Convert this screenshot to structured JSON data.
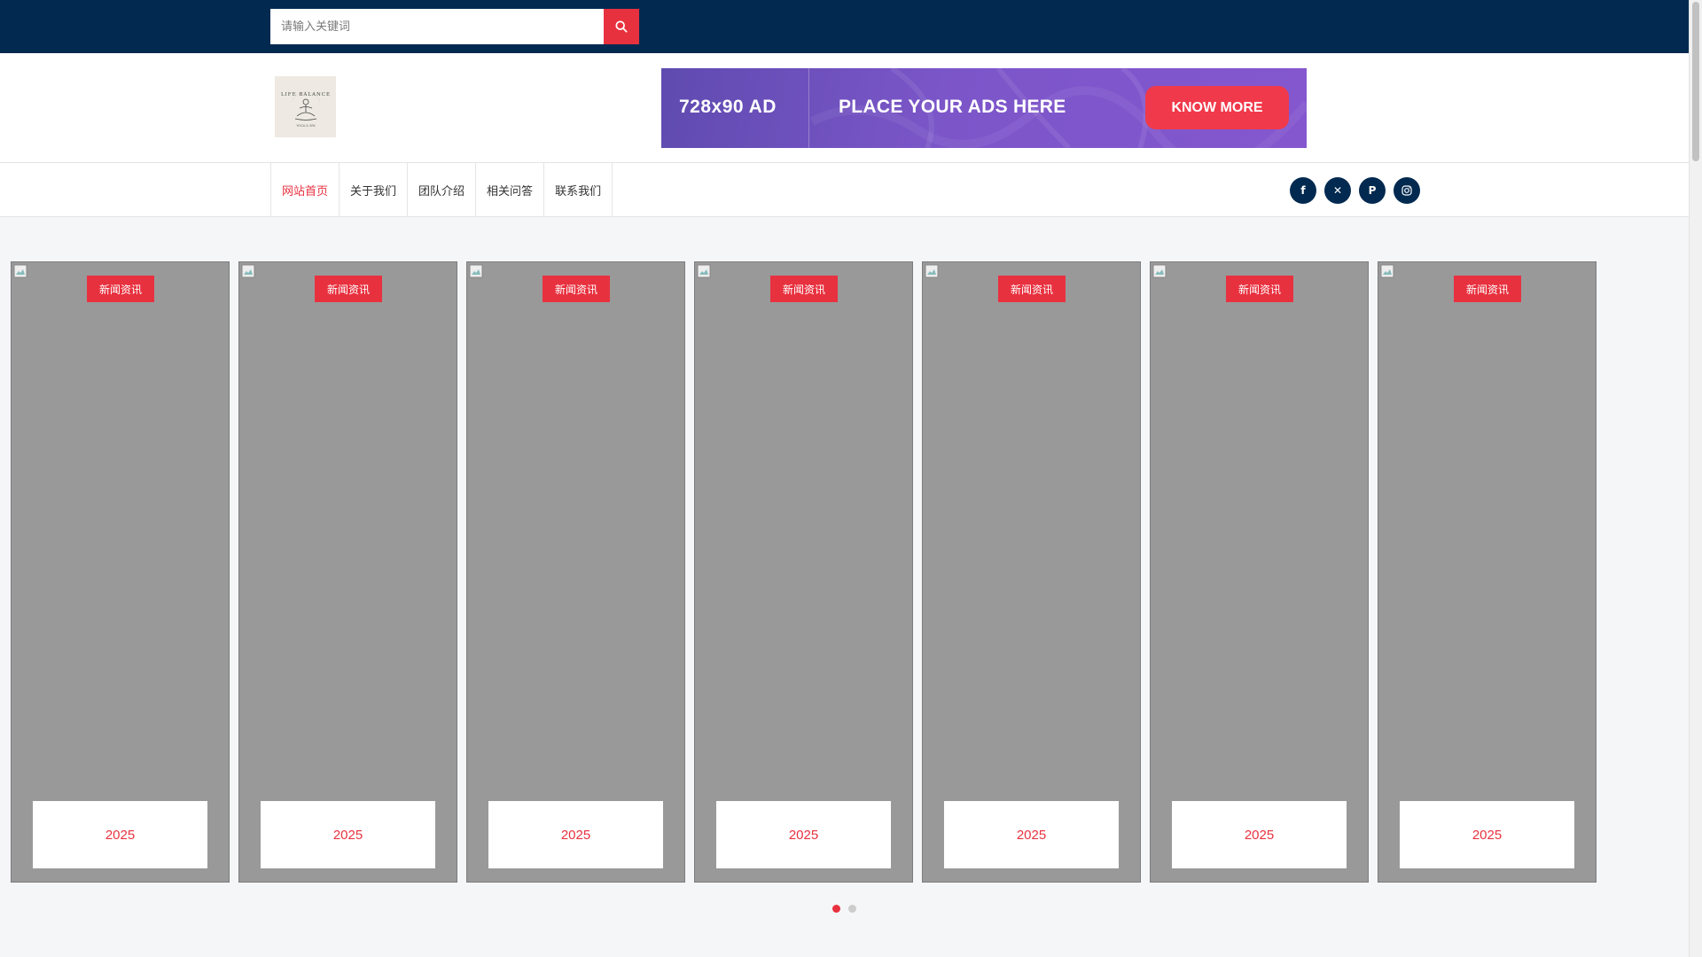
{
  "search": {
    "placeholder": "请输入关键词",
    "icon": "search-icon"
  },
  "logo": {
    "text_top": "LIFE BALANCE",
    "text_bottom": "YOGA & SPA"
  },
  "ad": {
    "size": "728x90 AD",
    "text": "PLACE YOUR ADS HERE",
    "cta": "KNOW MORE"
  },
  "nav": {
    "items": [
      {
        "label": "网站首页",
        "active": true
      },
      {
        "label": "关于我们",
        "active": false
      },
      {
        "label": "团队介绍",
        "active": false
      },
      {
        "label": "相关问答",
        "active": false
      },
      {
        "label": "联系我们",
        "active": false
      }
    ]
  },
  "social": [
    {
      "icon": "facebook-icon",
      "glyph": "f"
    },
    {
      "icon": "x-icon",
      "glyph": "✕"
    },
    {
      "icon": "pinterest-icon",
      "glyph": "P"
    },
    {
      "icon": "instagram-icon",
      "glyph": ""
    }
  ],
  "cards": [
    {
      "category": "新闻资讯",
      "year": "2025"
    },
    {
      "category": "新闻资讯",
      "year": "2025"
    },
    {
      "category": "新闻资讯",
      "year": "2025"
    },
    {
      "category": "新闻资讯",
      "year": "2025"
    },
    {
      "category": "新闻资讯",
      "year": "2025"
    },
    {
      "category": "新闻资讯",
      "year": "2025"
    },
    {
      "category": "新闻资讯",
      "year": "2025"
    }
  ],
  "pagination": {
    "count": 2,
    "active_index": 0
  },
  "colors": {
    "topbar": "#022a50",
    "accent": "#e8313f",
    "card_bg": "#999999",
    "page_bg": "#f5f6f8"
  }
}
